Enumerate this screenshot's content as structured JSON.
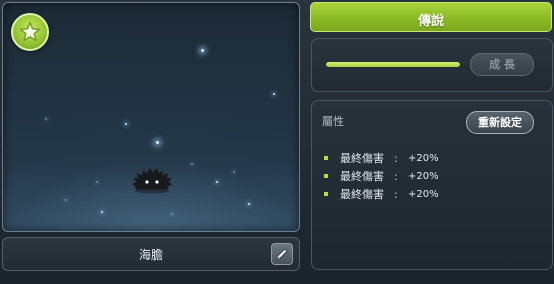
{
  "preview": {
    "grade_icon": "star-icon",
    "pet_sprite": "black-sea-urchin-pet"
  },
  "name_bar": {
    "pet_name": "海膽",
    "edit_icon": "pencil-icon"
  },
  "rank": {
    "label": "傳說",
    "color": "#8cbb25"
  },
  "growth": {
    "progress": 1.0,
    "button_label": "成 長"
  },
  "attributes": {
    "title": "屬性",
    "reset_label": "重新設定",
    "items": [
      {
        "name": "最終傷害",
        "sep": ":",
        "value": "+20%"
      },
      {
        "name": "最終傷害",
        "sep": ":",
        "value": "+20%"
      },
      {
        "name": "最終傷害",
        "sep": ":",
        "value": "+20%"
      }
    ]
  }
}
